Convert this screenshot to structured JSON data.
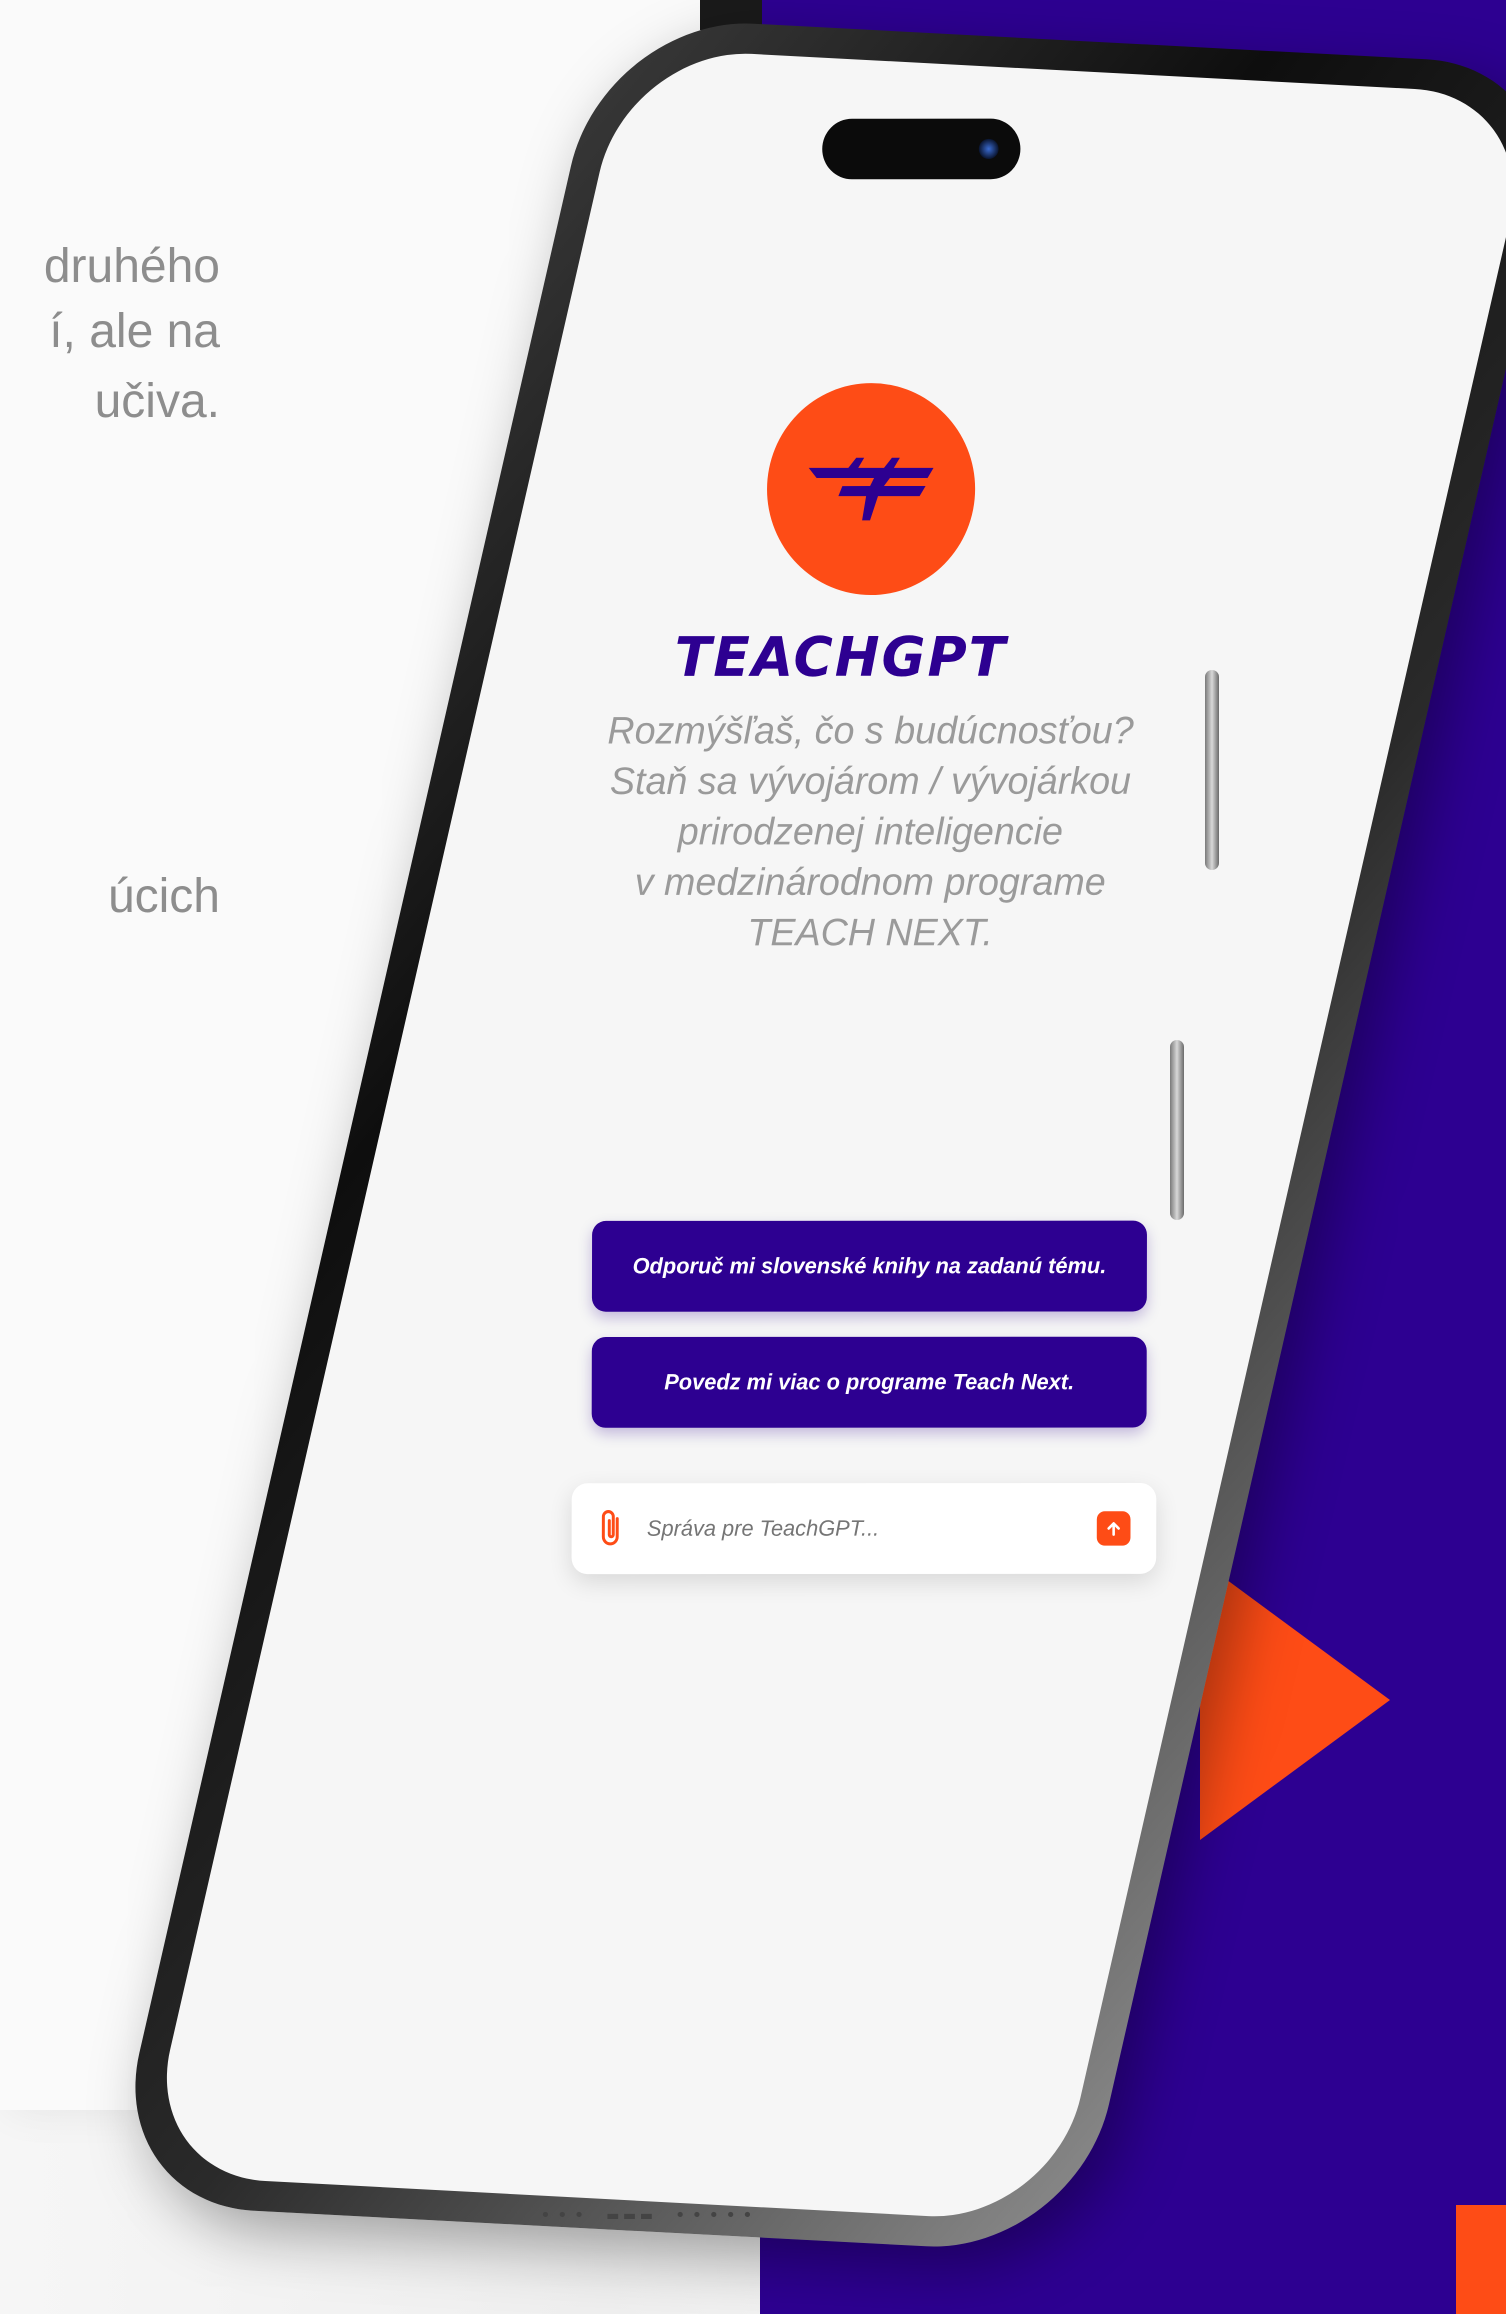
{
  "background_text": {
    "lines": [
      "druhého",
      "í, ale na",
      "učiva.",
      "úcich"
    ]
  },
  "app": {
    "logo_name": "TEACHGPT",
    "tagline_lines": [
      "Rozmýšľaš, čo s budúcnosťou?",
      "Staň sa vývojárom / vývojárkou",
      "prirodzenej inteligencie",
      "v medzinárodnom programe",
      "TEACH NEXT."
    ],
    "suggestions": [
      "Odporuč mi slovenské knihy na zadanú tému.",
      "Povedz mi viac o programe Teach Next."
    ],
    "input": {
      "placeholder": "Správa pre TeachGPT..."
    }
  },
  "colors": {
    "accent": "#fe4c16",
    "brand": "#2d0091",
    "screen_bg": "#f6f6f6",
    "muted_text": "#9a9a9a"
  },
  "icons": {
    "logo": "teachgpt-logo-icon",
    "attach": "paperclip-icon",
    "send": "arrow-up-icon"
  }
}
